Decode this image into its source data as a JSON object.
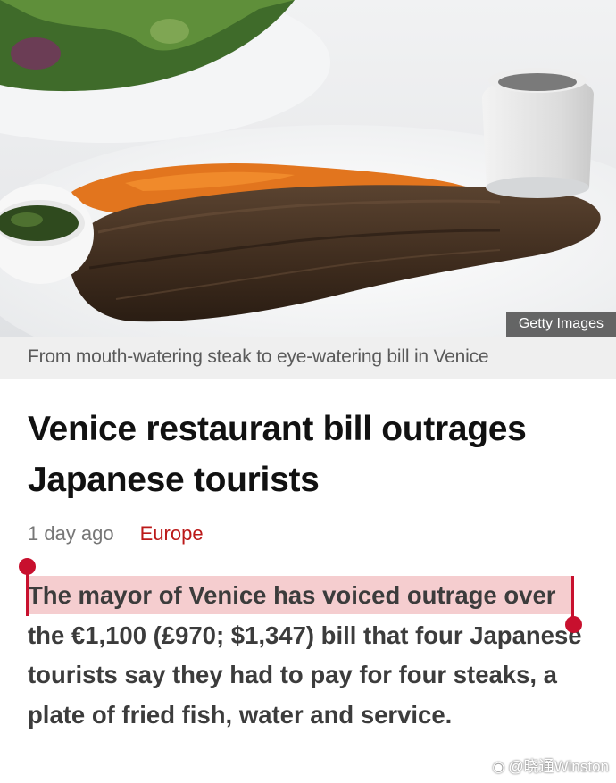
{
  "image": {
    "credit": "Getty Images",
    "alt_icon": "steak-photo"
  },
  "caption": "From mouth-watering steak to eye-watering bill in Venice",
  "article": {
    "headline": "Venice restaurant bill outrages Japanese tourists",
    "time_ago": "1 day ago",
    "section": "Europe",
    "selected_text": "The mayor of Venice has voiced outrage",
    "body_rest": " over the €1,100 (£970; $1,347) bill that four Japanese tourists say they had to pay for four steaks, a plate of fried fish, water and service."
  },
  "watermark": {
    "icon": "weibo-icon",
    "text": "@晓通Winston"
  },
  "colors": {
    "accent_red": "#bb1919",
    "selection_highlight": "#f5cdcf",
    "selection_handle": "#c8102e"
  }
}
